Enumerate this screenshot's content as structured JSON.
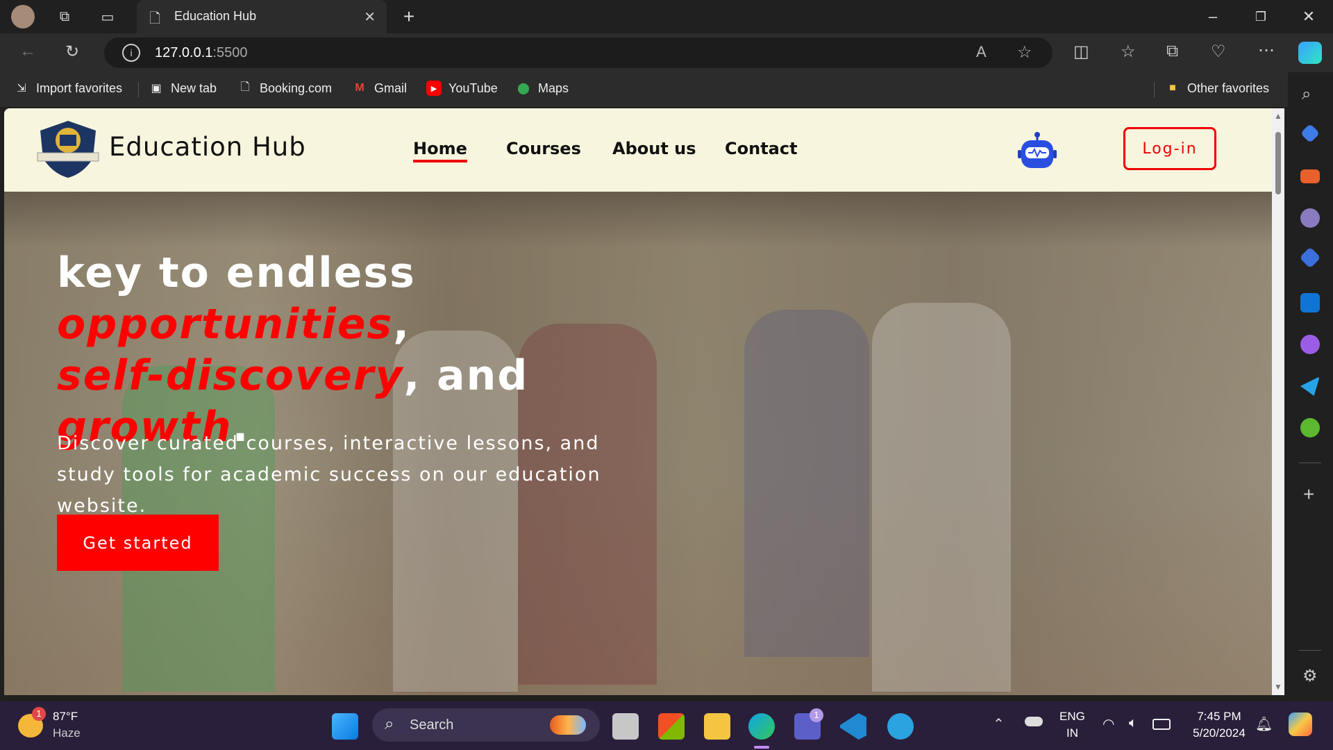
{
  "browser": {
    "tab_title": "Education Hub",
    "url_host": "127.0.0.1",
    "url_port": ":5500",
    "bookmarks": [
      "Import favorites",
      "New tab",
      "Booking.com",
      "Gmail",
      "YouTube",
      "Maps"
    ],
    "other_favorites": "Other favorites"
  },
  "site": {
    "brand": "Education Hub",
    "nav": [
      "Home",
      "Courses",
      "About us",
      "Contact"
    ],
    "login": "Log-in",
    "hero": {
      "t1": "key to endless ",
      "t2": "opportunities",
      "t3": ",",
      "t4": "self-discovery",
      "t5": ", and",
      "t6": "growth",
      "t7": ".",
      "subtitle": "Discover curated courses, interactive lessons, and study tools for academic success on our education website.",
      "cta": "Get started"
    },
    "accent_color": "#ff0000",
    "header_bg": "#f8f5de"
  },
  "taskbar": {
    "weather_temp": "87°F",
    "weather_desc": "Haze",
    "weather_badge": "1",
    "search_label": "Search",
    "teams_badge": "1",
    "lang1": "ENG",
    "lang2": "IN",
    "time": "7:45 PM",
    "date": "5/20/2024"
  }
}
